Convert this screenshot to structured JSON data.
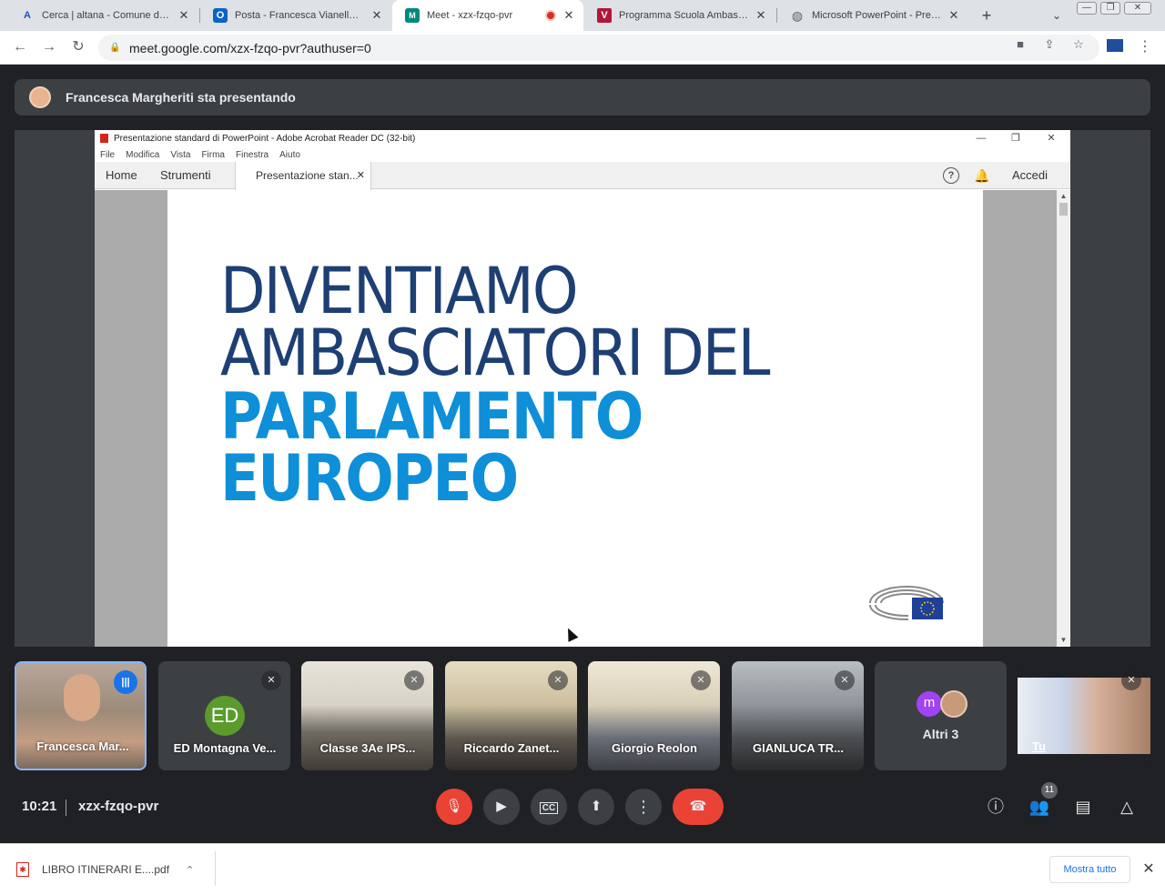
{
  "browser": {
    "tabs": [
      {
        "title": "Cerca | altana - Comune di Venezia",
        "favicon": "A"
      },
      {
        "title": "Posta - Francesca Vianello - Outlook",
        "favicon": "O"
      },
      {
        "title": "Meet - xzx-fzqo-pvr",
        "favicon": "M"
      },
      {
        "title": "Programma Scuola Ambasciatrice",
        "favicon": "V"
      },
      {
        "title": "Microsoft PowerPoint - Presentazione",
        "favicon": "globe"
      }
    ],
    "url": "meet.google.com/xzx-fzqo-pvr?authuser=0"
  },
  "meet": {
    "presenter_banner": "Francesca Margheriti sta presentando",
    "time": "10:21",
    "meeting_code": "xzx-fzqo-pvr",
    "participant_count": "11",
    "participants": [
      {
        "name": "Francesca Mar...",
        "muted": false
      },
      {
        "name": "ED Montagna Ve...",
        "initials": "ED",
        "muted": true
      },
      {
        "name": "Classe 3Ae IPS...",
        "muted": true
      },
      {
        "name": "Riccardo Zanet...",
        "muted": true
      },
      {
        "name": "Giorgio Reolon",
        "muted": true
      },
      {
        "name": "GIANLUCA TR...",
        "muted": true
      },
      {
        "name": "Altri 3",
        "initial": "m"
      },
      {
        "name": "Tu",
        "muted": true
      }
    ],
    "accent_red": "#ea4335",
    "accent_blue": "#1a73e8"
  },
  "acrobat": {
    "window_title": "Presentazione standard di PowerPoint - Adobe Acrobat Reader DC (32-bit)",
    "menu": [
      "File",
      "Modifica",
      "Vista",
      "Firma",
      "Finestra",
      "Aiuto"
    ],
    "nav_tabs": [
      "Home",
      "Strumenti"
    ],
    "doc_tab": "Presentazione stan...",
    "signin": "Accedi"
  },
  "slide": {
    "line1": "DIVENTIAMO",
    "line2": "AMBASCIATORI DEL",
    "line3": "PARLAMENTO",
    "line4": "EUROPEO",
    "color_dark": "#1e3f73",
    "color_light": "#0e8fd8"
  },
  "downloads": {
    "file": "LIBRO ITINERARI E....pdf",
    "show_all": "Mostra tutto"
  }
}
